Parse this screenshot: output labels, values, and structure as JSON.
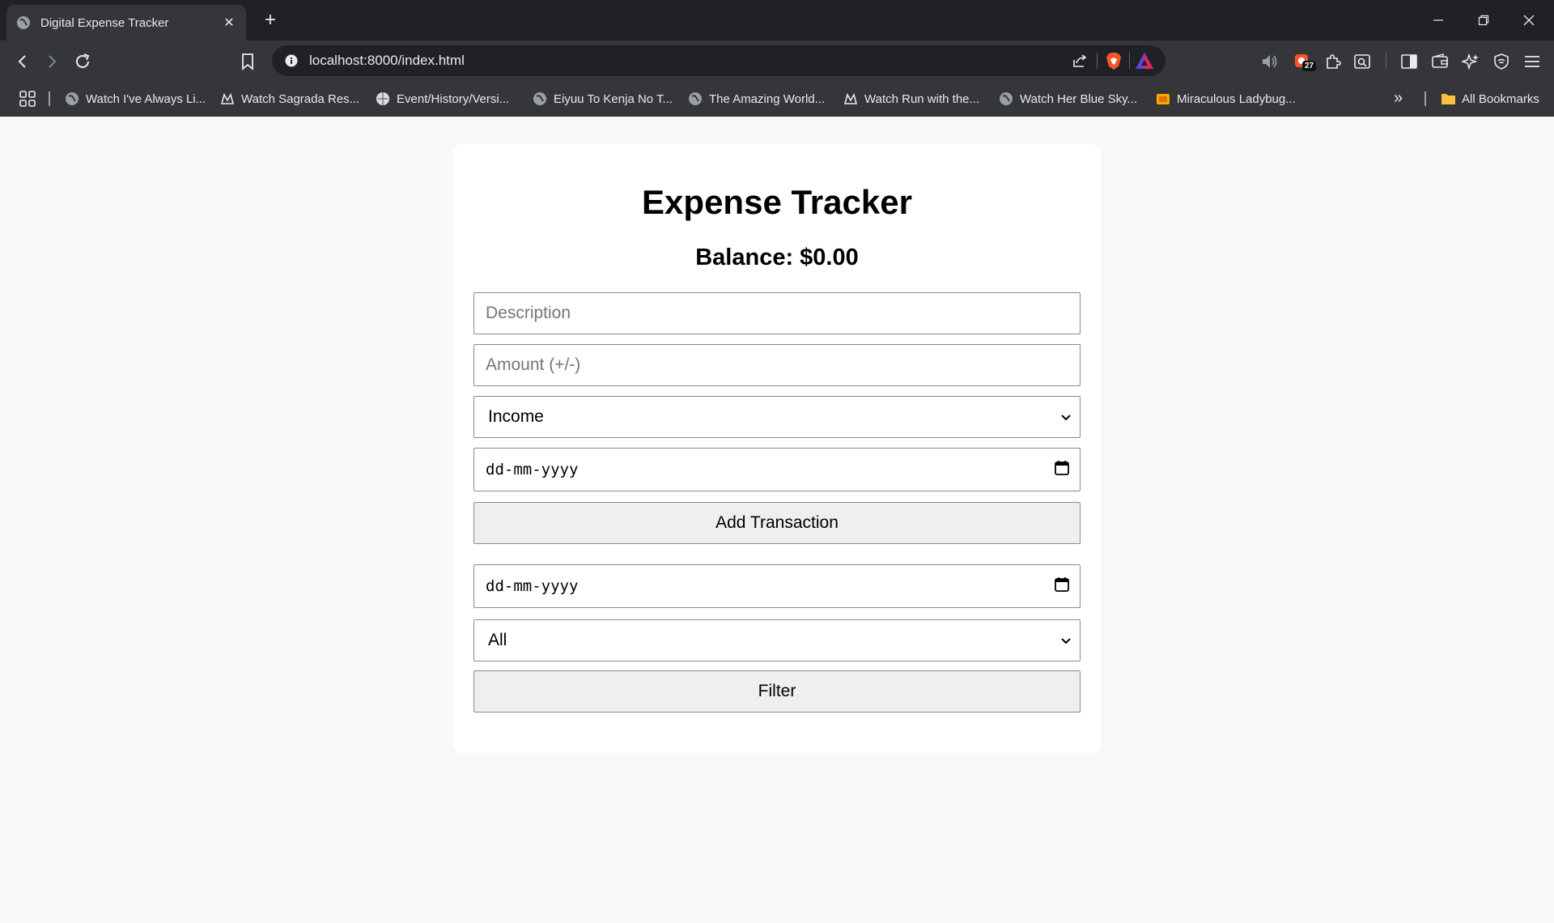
{
  "browser": {
    "tab": {
      "title": "Digital Expense Tracker",
      "close": "✕"
    },
    "new_tab": "+",
    "url": "localhost:8000/index.html",
    "extension_badge": "27",
    "bookmarks": [
      {
        "label": "Watch I've Always Li...",
        "icon": "globe-icon"
      },
      {
        "label": "Watch Sagrada Res...",
        "icon": "crown-logo-icon"
      },
      {
        "label": "Event/History/Versi...",
        "icon": "wiki-globe-icon"
      },
      {
        "label": "Eiyuu To Kenja No T...",
        "icon": "globe-icon"
      },
      {
        "label": "The Amazing World...",
        "icon": "globe-icon"
      },
      {
        "label": "Watch Run with the...",
        "icon": "crown-logo-icon"
      },
      {
        "label": "Watch Her Blue Sky...",
        "icon": "globe-icon"
      },
      {
        "label": "Miraculous Ladybug...",
        "icon": "tv-icon"
      }
    ],
    "all_bookmarks": "All Bookmarks",
    "colors": {
      "tabbar": "#202124",
      "toolbar": "#35363a",
      "brave": "#fb542b"
    }
  },
  "page": {
    "title": "Expense Tracker",
    "balance": "Balance: $0.00",
    "form": {
      "description_placeholder": "Description",
      "amount_placeholder": "Amount (+/-)",
      "type_selected": "Income",
      "date_placeholder": "dd-mm-yyyy",
      "add_button": "Add Transaction"
    },
    "filter": {
      "date_placeholder": "dd-mm-yyyy",
      "type_selected": "All",
      "filter_button": "Filter"
    }
  }
}
